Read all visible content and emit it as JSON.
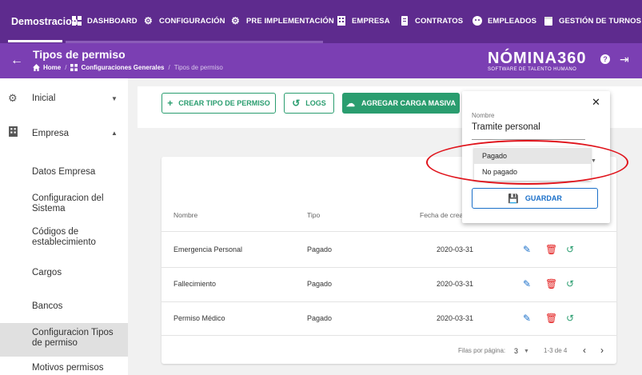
{
  "topnav": {
    "brand": "Demostracion",
    "items": [
      {
        "label": "DASHBOARD",
        "icon": "dashboard-icon"
      },
      {
        "label": "CONFIGURACIÓN",
        "icon": "gear-icon"
      },
      {
        "label": "PRE IMPLEMENTACIÓN",
        "icon": "gear-icon"
      },
      {
        "label": "EMPRESA",
        "icon": "building-icon"
      },
      {
        "label": "CONTRATOS",
        "icon": "document-icon"
      },
      {
        "label": "EMPLEADOS",
        "icon": "face-icon"
      },
      {
        "label": "GESTIÓN DE TURNOS",
        "icon": "calendar-icon"
      }
    ]
  },
  "subheader": {
    "title": "Tipos de permiso",
    "breadcrumb": [
      "Home",
      "Configuraciones Generales",
      "Tipos de permiso"
    ],
    "logo_main": "NÓMINA360",
    "logo_sub": "SOFTWARE DE TALENTO HUMANO"
  },
  "sidebar": {
    "items": [
      {
        "label": "Inicial",
        "icon": "gear-icon",
        "caret": "▼"
      },
      {
        "label": "Empresa",
        "icon": "building-icon",
        "caret": "▲"
      }
    ],
    "subitems": [
      "Datos Empresa",
      "Configuracion del Sistema",
      "Códigos de establecimiento",
      "Cargos",
      "Bancos",
      "Configuracion Tipos de permiso",
      "Motivos permisos"
    ]
  },
  "actions": {
    "create": "CREAR TIPO DE PERMISO",
    "logs": "LOGS",
    "bulk": "AGREGAR CARGA MASIVA"
  },
  "table": {
    "headers": [
      "Nombre",
      "Tipo",
      "Fecha de crea"
    ],
    "rows": [
      {
        "nombre": "Emergencia Personal",
        "tipo": "Pagado",
        "fecha": "2020-03-31"
      },
      {
        "nombre": "Fallecimiento",
        "tipo": "Pagado",
        "fecha": "2020-03-31"
      },
      {
        "nombre": "Permiso Médico",
        "tipo": "Pagado",
        "fecha": "2020-03-31"
      }
    ],
    "footer": {
      "rows_per_page_label": "Filas por página:",
      "rows_per_page": "3",
      "range": "1-3 de 4"
    }
  },
  "popup": {
    "field_label": "Nombre",
    "field_value": "Tramite personal",
    "options": [
      "Pagado",
      "No pagado"
    ],
    "selected_option": "Pagado",
    "save": "GUARDAR"
  },
  "colors": {
    "nav_bg": "#5e2b8e",
    "subheader_bg": "#7b3fb3",
    "green": "#2a9d6f",
    "blue": "#1a6fc9",
    "red": "#e21b1b",
    "highlight": "#e0141c"
  }
}
